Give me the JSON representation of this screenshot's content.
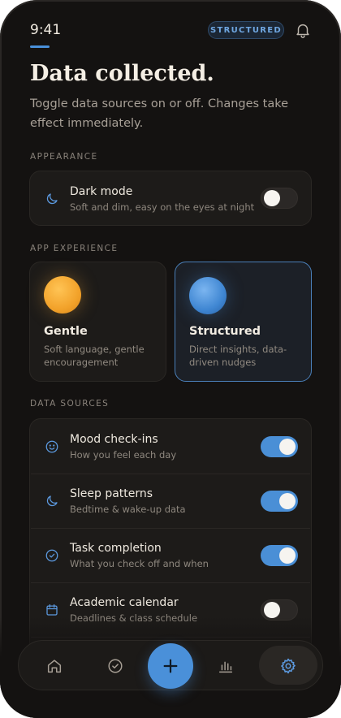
{
  "status": {
    "time": "9:41",
    "mode_badge": "STRUCTURED"
  },
  "header": {
    "title": "Data collected.",
    "subtitle": "Toggle data sources on or off. Changes take effect immediately."
  },
  "appearance": {
    "section_label": "APPEARANCE",
    "dark_mode": {
      "title": "Dark mode",
      "subtitle": "Soft and dim, easy on the eyes at night",
      "enabled": false,
      "icon": "moon-icon"
    }
  },
  "experience": {
    "section_label": "APP EXPERIENCE",
    "options": [
      {
        "title": "Gentle",
        "description": "Soft language, gentle encouragement",
        "selected": false,
        "orb_color": "#f2a93b"
      },
      {
        "title": "Structured",
        "description": "Direct insights, data-driven nudges",
        "selected": true,
        "orb_color": "#4a90d9"
      }
    ]
  },
  "data_sources": {
    "section_label": "DATA SOURCES",
    "items": [
      {
        "title": "Mood check-ins",
        "subtitle": "How you feel each day",
        "enabled": true,
        "icon": "smile-icon"
      },
      {
        "title": "Sleep patterns",
        "subtitle": "Bedtime & wake-up data",
        "enabled": true,
        "icon": "moon-icon"
      },
      {
        "title": "Task completion",
        "subtitle": "What you check off and when",
        "enabled": true,
        "icon": "check-circle-icon"
      },
      {
        "title": "Academic calendar",
        "subtitle": "Deadlines & class schedule",
        "enabled": false,
        "icon": "calendar-icon"
      }
    ]
  },
  "nav": {
    "items": [
      "home-icon",
      "check-circle-icon",
      "plus-icon",
      "bar-chart-icon",
      "gear-icon"
    ],
    "active": "gear-icon"
  },
  "colors": {
    "accent": "#4a90d9",
    "background": "#141211",
    "card": "#1d1b19",
    "gentle": "#f2a93b"
  }
}
